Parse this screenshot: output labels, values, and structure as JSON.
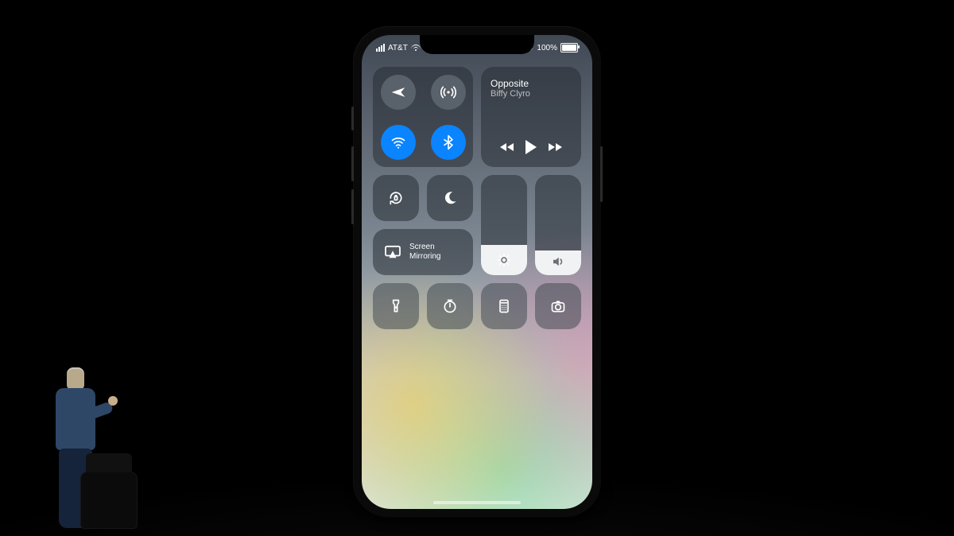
{
  "status": {
    "carrier": "AT&T",
    "battery_text": "100%"
  },
  "music": {
    "track": "Opposite",
    "artist": "Biffy Clyro"
  },
  "screen_mirroring_label": "Screen\nMirroring",
  "controls": {
    "brightness_percent": 30,
    "volume_percent": 25,
    "wifi_on": true,
    "bluetooth_on": true,
    "airplane_on": false,
    "cellular_on": false
  },
  "colors": {
    "active_blue": "#0a84ff",
    "panel_bg": "rgba(40,45,52,0.55)"
  },
  "icons": {
    "airplane": "airplane-icon",
    "cellular": "cellular-icon",
    "wifi": "wifi-icon",
    "bluetooth": "bluetooth-icon",
    "orientation_lock": "orientation-lock-icon",
    "do_not_disturb": "moon-icon",
    "screen_mirroring": "screen-mirroring-icon",
    "brightness": "sun-icon",
    "volume": "speaker-icon",
    "flashlight": "flashlight-icon",
    "timer": "timer-icon",
    "calculator": "calculator-icon",
    "camera": "camera-icon",
    "previous": "rewind-icon",
    "play": "play-icon",
    "next": "fast-forward-icon",
    "bluetooth_status": "bluetooth-icon",
    "wifi_status": "wifi-icon",
    "signal_status": "signal-icon",
    "battery_status": "battery-icon"
  }
}
